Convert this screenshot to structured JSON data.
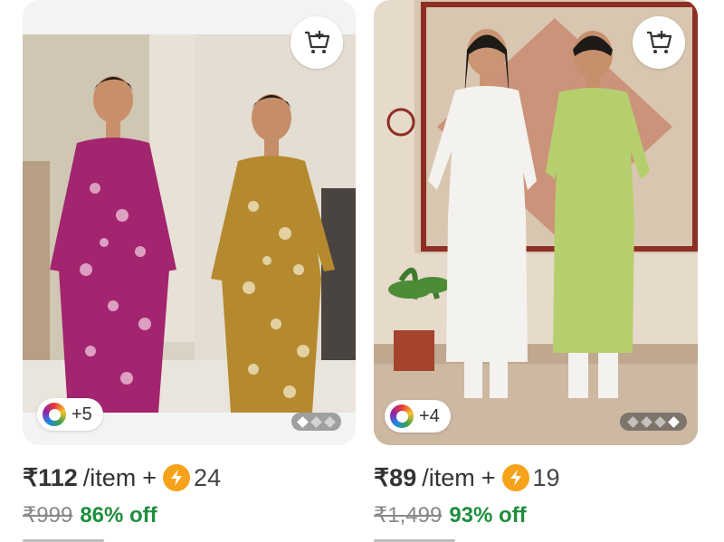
{
  "products": [
    {
      "price": "₹112",
      "unit": "/item",
      "plus": "+",
      "coins": "24",
      "mrp": "₹999",
      "discount": "86% off",
      "swatch_count": "+5",
      "images_count": 3,
      "active_image": 1,
      "image_desc": "two models in floral kurtas, magenta and mustard",
      "icons": {
        "cart": "add-to-cart-icon",
        "swatch": "color-ring-icon",
        "coin": "lightning-coin-icon"
      }
    },
    {
      "price": "₹89",
      "unit": "/item",
      "plus": "+",
      "coins": "19",
      "mrp": "₹1,499",
      "discount": "93% off",
      "swatch_count": "+4",
      "images_count": 4,
      "active_image": 4,
      "image_desc": "two models in white and lime green kurta sets",
      "icons": {
        "cart": "add-to-cart-icon",
        "swatch": "color-ring-icon",
        "coin": "lightning-coin-icon"
      }
    }
  ],
  "colors": {
    "discount_green": "#1e8e3e",
    "coin_orange": "#f6a21a",
    "kurta_magenta": "#a3246f",
    "kurta_mustard": "#b5892e",
    "kurta_white": "#f4f2ee",
    "kurta_lime": "#b6cf6e"
  }
}
